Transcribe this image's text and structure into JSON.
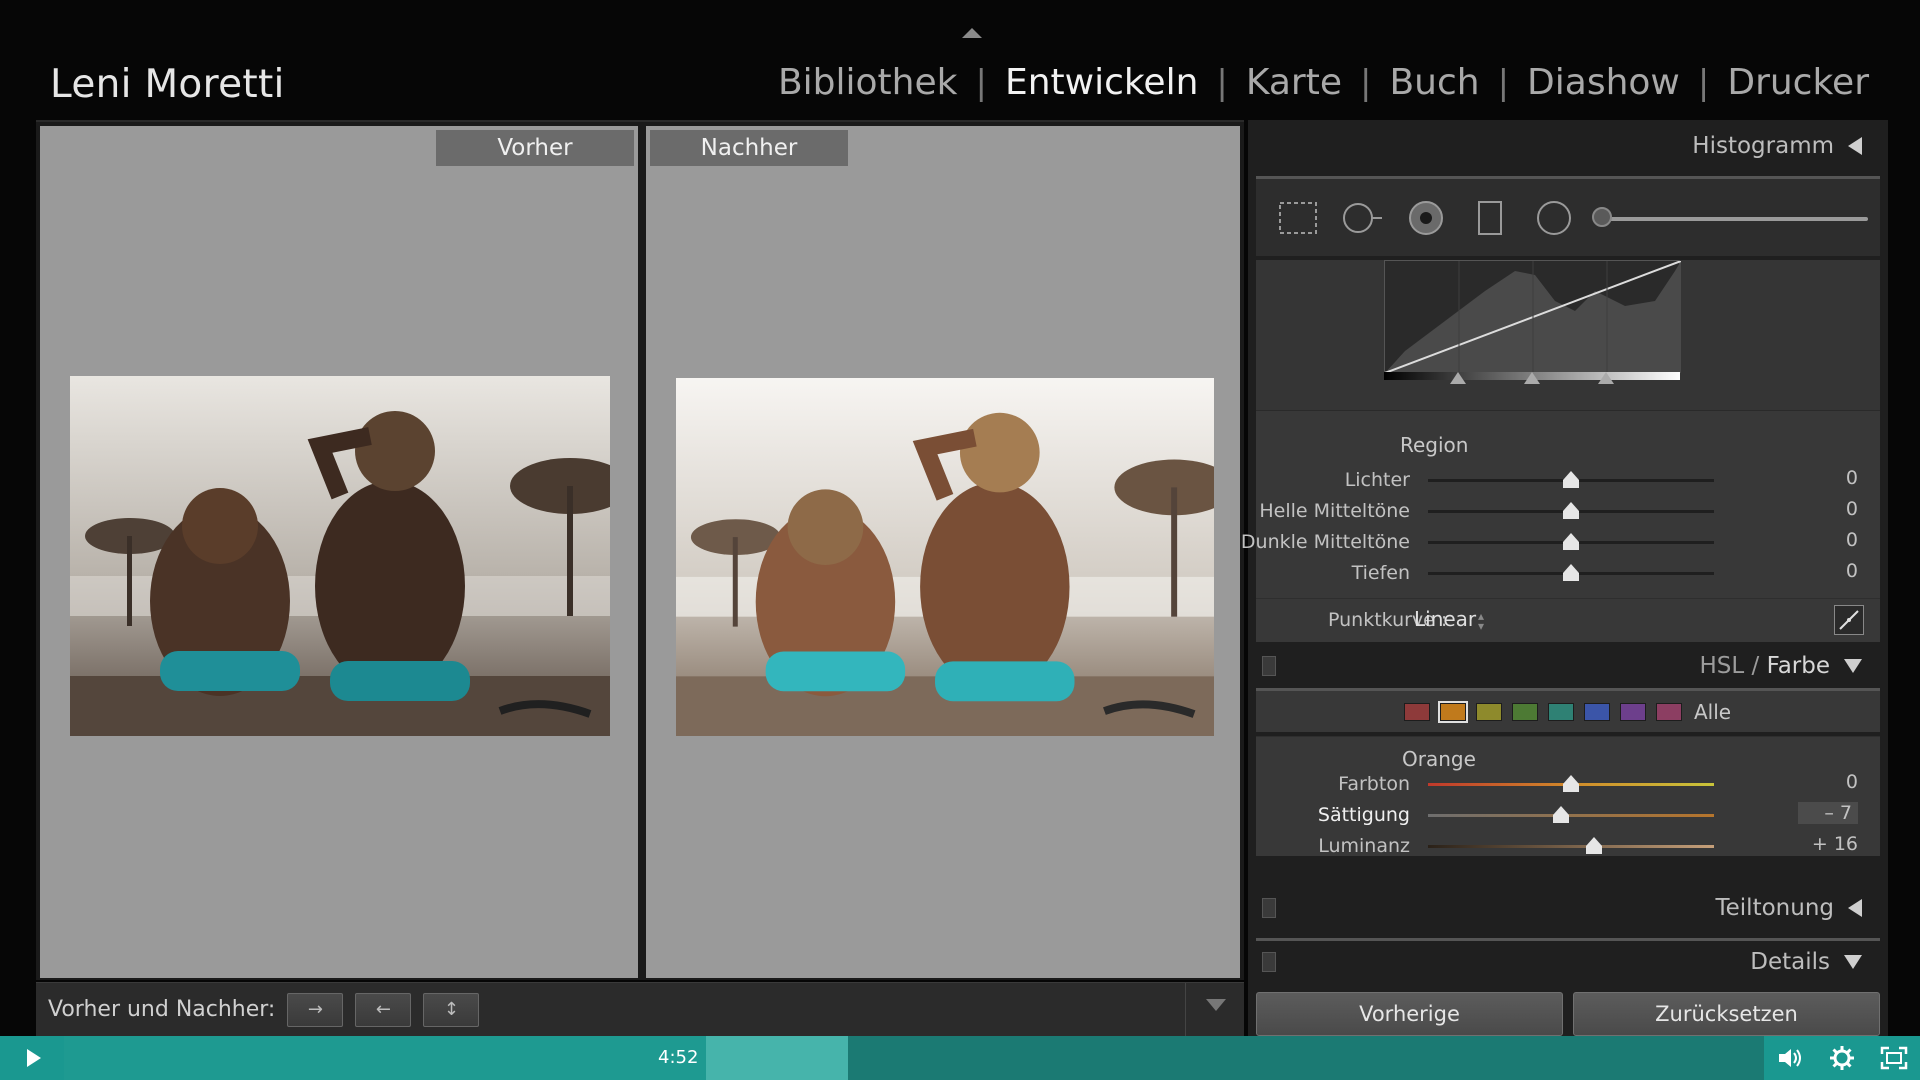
{
  "identity_plate": "Leni Moretti",
  "modules": [
    {
      "label": "Bibliothek",
      "active": false
    },
    {
      "label": "Entwickeln",
      "active": true
    },
    {
      "label": "Karte",
      "active": false
    },
    {
      "label": "Buch",
      "active": false
    },
    {
      "label": "Diashow",
      "active": false
    },
    {
      "label": "Drucker",
      "active": false
    }
  ],
  "compare": {
    "before_label": "Vorher",
    "after_label": "Nachher",
    "toolbar_label": "Vorher und Nachher:",
    "toolbar_buttons": [
      "→",
      "←",
      "↕"
    ]
  },
  "right_panel": {
    "histogram_title": "Histogramm",
    "region": {
      "title": "Region",
      "sliders": [
        {
          "name": "Lichter",
          "value": "0",
          "pos": 0.5
        },
        {
          "name": "Helle Mitteltöne",
          "value": "0",
          "pos": 0.5
        },
        {
          "name": "Dunkle Mitteltöne",
          "value": "0",
          "pos": 0.5
        },
        {
          "name": "Tiefen",
          "value": "0",
          "pos": 0.5
        }
      ]
    },
    "punktkurve_label": "Punktkurve :",
    "punktkurve_value": "Linear",
    "hsl": {
      "title_hsl": "HSL",
      "title_slash": " / ",
      "title_farbe": "Farbe",
      "swatches": [
        {
          "name": "red",
          "color": "#8e3a3a"
        },
        {
          "name": "orange",
          "color": "#c07a1c"
        },
        {
          "name": "yellow",
          "color": "#8e8a2c"
        },
        {
          "name": "green",
          "color": "#4d7a34"
        },
        {
          "name": "aqua",
          "color": "#2f8174"
        },
        {
          "name": "blue",
          "color": "#3b55a8"
        },
        {
          "name": "purple",
          "color": "#6d3f8c"
        },
        {
          "name": "magenta",
          "color": "#8c3e62"
        }
      ],
      "all_label": "Alle",
      "channel_title": "Orange",
      "sliders": [
        {
          "name": "Farbton",
          "value": "0",
          "pos": 0.5
        },
        {
          "name": "Sättigung",
          "value": "– 7",
          "pos": 0.465
        },
        {
          "name": "Luminanz",
          "value": "+ 16",
          "pos": 0.58
        }
      ]
    },
    "teiltonung_title": "Teiltonung",
    "details_title": "Details",
    "prev_button": "Vorherige",
    "reset_button": "Zurücksetzen"
  },
  "player": {
    "time": "4:52",
    "progress": 0.37
  }
}
